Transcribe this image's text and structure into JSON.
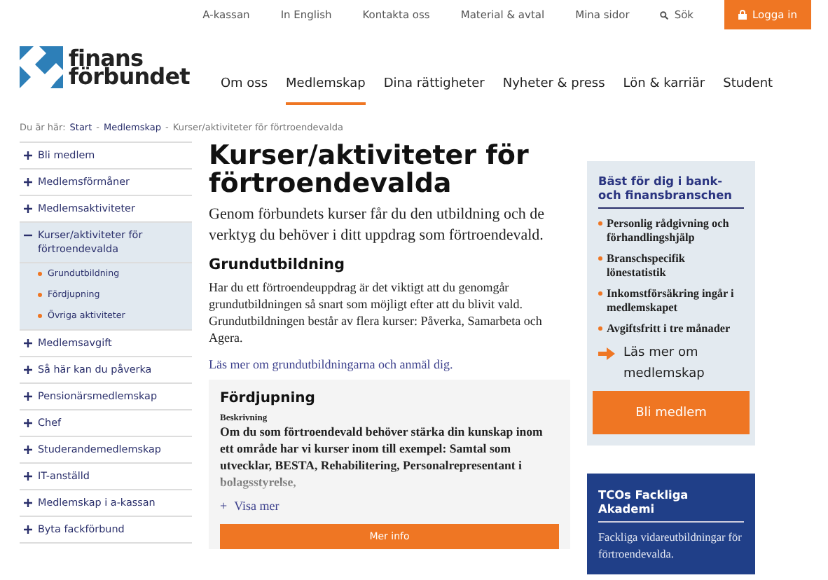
{
  "top_links": [
    "A-kassan",
    "In English",
    "Kontakta oss",
    "Material & avtal",
    "Mina sidor"
  ],
  "search": {
    "label": "Sök"
  },
  "login": {
    "label": "Logga in"
  },
  "logo": {
    "line1": "finans",
    "line2": "förbundet"
  },
  "nav": [
    {
      "label": "Om oss",
      "selected": false
    },
    {
      "label": "Medlemskap",
      "selected": true
    },
    {
      "label": "Dina rättigheter",
      "selected": false
    },
    {
      "label": "Nyheter & press",
      "selected": false
    },
    {
      "label": "Lön & karriär",
      "selected": false
    },
    {
      "label": "Student",
      "selected": false
    }
  ],
  "breadcrumb": {
    "prefix": "Du är här:",
    "separator": "-",
    "links": [
      "Start",
      "Medlemskap"
    ],
    "current": "Kurser/aktiviteter för förtroendevalda"
  },
  "sidebar": {
    "items": [
      {
        "label": "Bli medlem",
        "expanded": false
      },
      {
        "label": "Medlemsförmåner",
        "expanded": false
      },
      {
        "label": "Medlemsaktiviteter",
        "expanded": false
      },
      {
        "label": "Kurser/aktiviteter för förtroendevalda",
        "expanded": true,
        "children": [
          {
            "label": "Grundutbildning"
          },
          {
            "label": "Fördjupning"
          },
          {
            "label": "Övriga aktiviteter"
          }
        ]
      },
      {
        "label": "Medlemsavgift",
        "expanded": false
      },
      {
        "label": "Så här kan du påverka",
        "expanded": false
      },
      {
        "label": "Pensionärsmedlemskap",
        "expanded": false
      },
      {
        "label": "Chef",
        "expanded": false
      },
      {
        "label": "Studerandemedlemskap",
        "expanded": false
      },
      {
        "label": "IT-anställd",
        "expanded": false
      },
      {
        "label": "Medlemskap i a-kassan",
        "expanded": false
      },
      {
        "label": "Byta fackförbund",
        "expanded": false
      }
    ]
  },
  "main": {
    "title": "Kurser/aktiviteter för förtroendevalda",
    "lead": "Genom förbundets kurser får du den utbildning och de verktyg du behöver i ditt uppdrag som förtroendevald.",
    "section_title": "Grundutbildning",
    "section_text": "Har du ett förtroendeuppdrag är det viktigt att du genomgår grundutbildningen så snart som möjligt efter att du blivit vald. Grundutbildningen består av flera kurser: Påverka, Samarbeta och Agera.",
    "section_link": "Läs mer om grundutbildningarna och anmäl dig.",
    "card": {
      "title": "Fördjupning",
      "label": "Beskrivning",
      "text": "Om du som förtroendevald behöver stärka din kunskap inom ett område har vi kurser inom till exempel: Samtal som utvecklar, BESTA, Rehabilitering, Personalrepresentant i bolagsstyrelse,",
      "toggle_icon": "+",
      "toggle": "Visa mer",
      "button": "Mer info"
    }
  },
  "aside": {
    "title": "Bäst för dig i bank- och finansbranschen",
    "bullets": [
      "Personlig rådgivning och förhandlingshjälp",
      "Branschspecifik lönestatistik",
      "Inkomstförsäkring ingår i medlemskapet",
      "Avgiftsfritt i tre månader"
    ],
    "link": "Läs mer om medlemskap",
    "button": "Bli medlem"
  },
  "promo": {
    "title": "TCOs Fackliga Akademi",
    "text": "Fackliga vidareutbildningar för förtroendevalda."
  }
}
